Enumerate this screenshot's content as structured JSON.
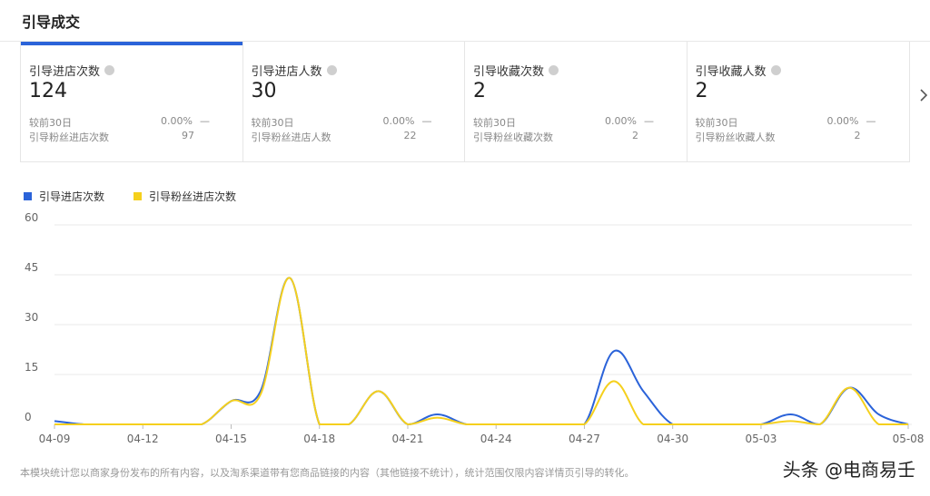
{
  "header": {
    "title": "引导成交"
  },
  "cards": [
    {
      "title": "引导进店次数",
      "value": "124",
      "cmp_label": "较前30日",
      "cmp_value": "0.00%",
      "cmp_trend": "—",
      "sub_label": "引导粉丝进店次数",
      "sub_value": "97"
    },
    {
      "title": "引导进店人数",
      "value": "30",
      "cmp_label": "较前30日",
      "cmp_value": "0.00%",
      "cmp_trend": "—",
      "sub_label": "引导粉丝进店人数",
      "sub_value": "22"
    },
    {
      "title": "引导收藏次数",
      "value": "2",
      "cmp_label": "较前30日",
      "cmp_value": "0.00%",
      "cmp_trend": "—",
      "sub_label": "引导粉丝收藏次数",
      "sub_value": "2"
    },
    {
      "title": "引导收藏人数",
      "value": "2",
      "cmp_label": "较前30日",
      "cmp_value": "0.00%",
      "cmp_trend": "—",
      "sub_label": "引导粉丝收藏人数",
      "sub_value": "2"
    }
  ],
  "icons": {
    "info": "info-circle-icon",
    "next": "chevron-right-icon"
  },
  "colors": {
    "series1": "#2b63d9",
    "series2": "#f5d01d",
    "accent": "#2b63d9",
    "grid": "#e9e9e9"
  },
  "chart_data": {
    "type": "line",
    "title": "",
    "xlabel": "",
    "ylabel": "",
    "ylim": [
      0,
      60
    ],
    "yticks": [
      0,
      15,
      30,
      45,
      60
    ],
    "grid": true,
    "legend": "top-left",
    "x": [
      "04-09",
      "04-10",
      "04-11",
      "04-12",
      "04-13",
      "04-14",
      "04-15",
      "04-16",
      "04-17",
      "04-18",
      "04-19",
      "04-20",
      "04-21",
      "04-22",
      "04-23",
      "04-24",
      "04-25",
      "04-26",
      "04-27",
      "04-28",
      "04-29",
      "04-30",
      "05-01",
      "05-02",
      "05-03",
      "05-04",
      "05-05",
      "05-06",
      "05-07",
      "05-08"
    ],
    "xticks": [
      "04-09",
      "04-12",
      "04-15",
      "04-18",
      "04-21",
      "04-24",
      "04-27",
      "04-30",
      "05-03",
      "05-08"
    ],
    "series": [
      {
        "name": "引导进店次数",
        "color": "#2b63d9",
        "values": [
          1,
          0,
          0,
          0,
          0,
          0,
          7,
          10,
          44,
          0,
          0,
          10,
          0,
          3,
          0,
          0,
          0,
          0,
          0,
          22,
          10,
          0,
          0,
          0,
          0,
          3,
          0,
          11,
          3,
          0
        ]
      },
      {
        "name": "引导粉丝进店次数",
        "color": "#f5d01d",
        "values": [
          0,
          0,
          0,
          0,
          0,
          0,
          7,
          9,
          44,
          0,
          0,
          10,
          0,
          2,
          0,
          0,
          0,
          0,
          0,
          13,
          0,
          0,
          0,
          0,
          0,
          1,
          0,
          11,
          0,
          0
        ]
      }
    ]
  },
  "footnote": "本模块统计您以商家身份发布的所有内容，以及淘系渠道带有您商品链接的内容（其他链接不统计），统计范围仅限内容详情页引导的转化。",
  "watermark": "头条 @电商易壬"
}
